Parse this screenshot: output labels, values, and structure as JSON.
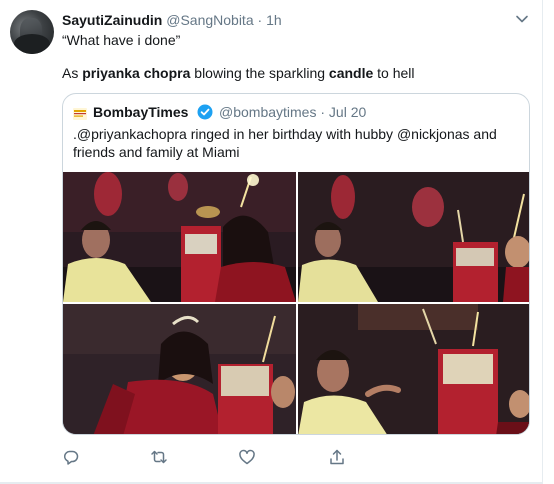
{
  "tweet": {
    "display_name": "SayutiZainudin",
    "handle": "@SangNobita",
    "separator": "·",
    "time": "1h",
    "line1": "“What have i done”",
    "line2_parts": [
      {
        "text": "As ",
        "bold": false
      },
      {
        "text": "priyanka chopra",
        "bold": true
      },
      {
        "text": " blowing the sparkling ",
        "bold": false
      },
      {
        "text": "candle",
        "bold": true
      },
      {
        "text": " to hell",
        "bold": false
      }
    ]
  },
  "quoted": {
    "display_name": "BombayTimes",
    "handle": "@bombaytimes",
    "separator": "·",
    "date": "Jul 20",
    "text": ".@priyankachopra ringed in her birthday with hubby @nickjonas and friends and family at Miami",
    "verified": true
  },
  "icons": {
    "avatar": "avatar-image",
    "caret": "chevron-down-icon",
    "logo": "bombay-times-logo-icon",
    "verified": "verified-badge-icon",
    "reply": "reply-icon",
    "retweet": "retweet-icon",
    "like": "like-icon",
    "share": "share-icon"
  },
  "colors": {
    "text": "#14171a",
    "secondary": "#657786",
    "border": "#ccd6dd",
    "verified": "#1da1f2",
    "action": "#657786"
  }
}
